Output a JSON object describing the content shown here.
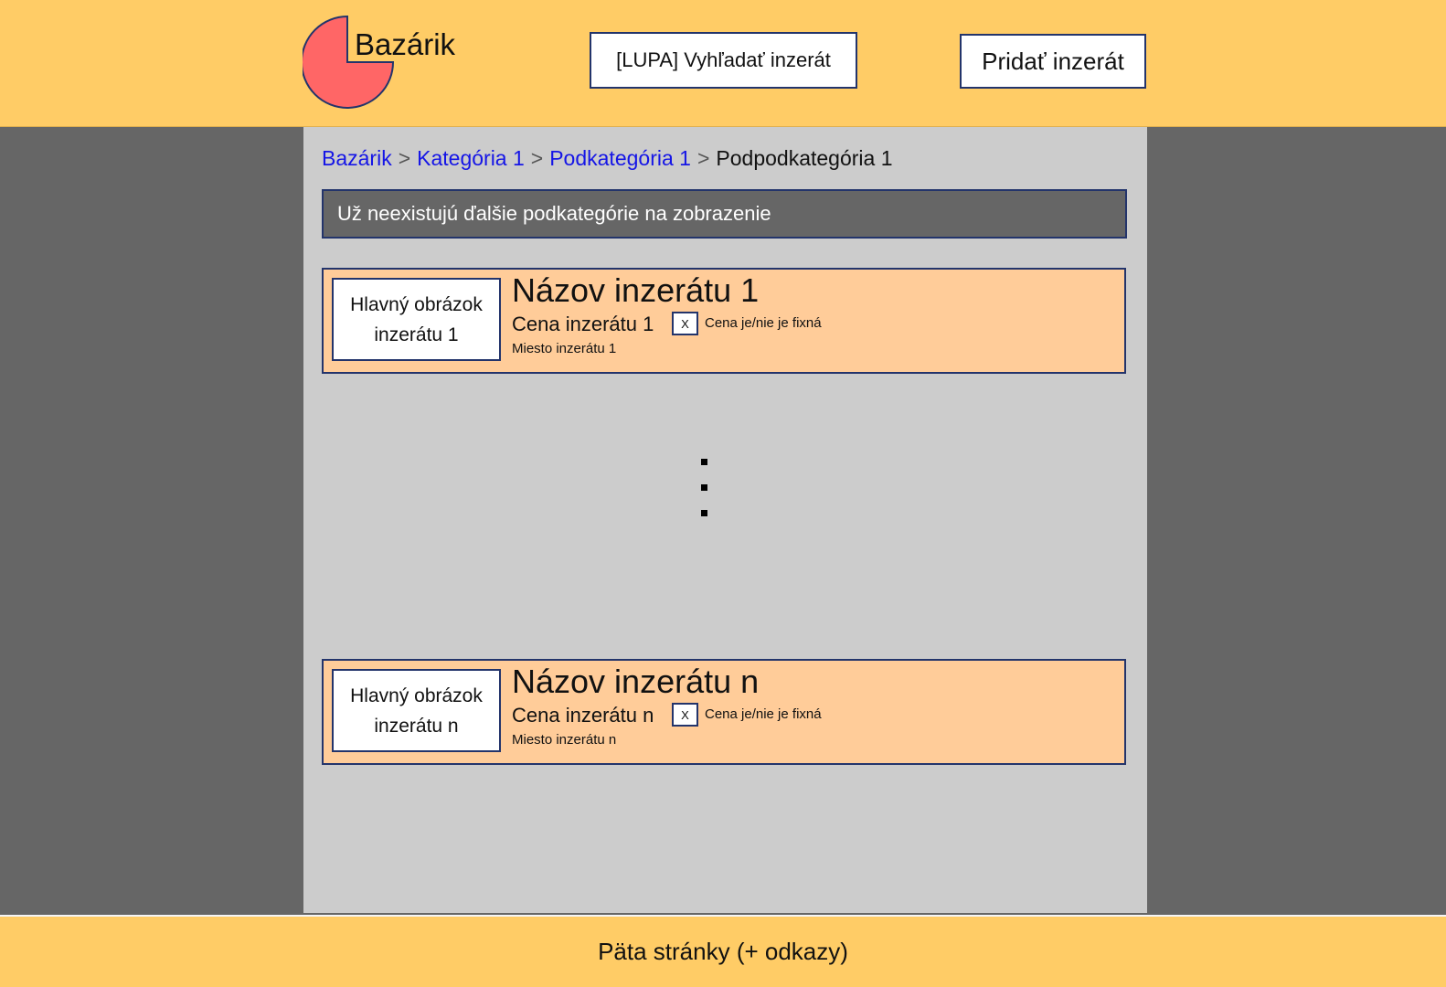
{
  "header": {
    "brand": "Bazárik",
    "search_label": "[LUPA] Vyhľadať inzerát",
    "add_label": "Pridať inzerát",
    "logo_color": "#FF6666",
    "background": "#FFCC66"
  },
  "breadcrumb": {
    "items": [
      {
        "label": "Bazárik",
        "link": true
      },
      {
        "label": "Kategória 1",
        "link": true
      },
      {
        "label": "Podkategória 1",
        "link": true
      },
      {
        "label": "Podpodkategória 1",
        "link": false
      }
    ],
    "separator": ">"
  },
  "notice": "Už neexistujú ďalšie podkategórie na zobrazenie",
  "ads": [
    {
      "image_line1": "Hlavný obrázok",
      "image_line2": "inzerátu 1",
      "title": "Názov inzerátu 1",
      "price": "Cena inzerátu 1",
      "checkbox": "X",
      "fixed_label": "Cena je/nie je fixná",
      "place": "Miesto inzerátu 1"
    },
    {
      "image_line1": "Hlavný obrázok",
      "image_line2": "inzerátu n",
      "title": "Názov inzerátu n",
      "price": "Cena inzerátu n",
      "checkbox": "X",
      "fixed_label": "Cena je/nie je fixná",
      "place": "Miesto inzerátu n"
    }
  ],
  "footer": {
    "text": "Päta stránky (+ odkazy)"
  },
  "colors": {
    "accent": "#FFCC66",
    "ad_background": "#FFCC99",
    "content_background": "#CCCCCC",
    "page_background": "#666666",
    "border": "#23346b",
    "link": "#1515e6"
  }
}
